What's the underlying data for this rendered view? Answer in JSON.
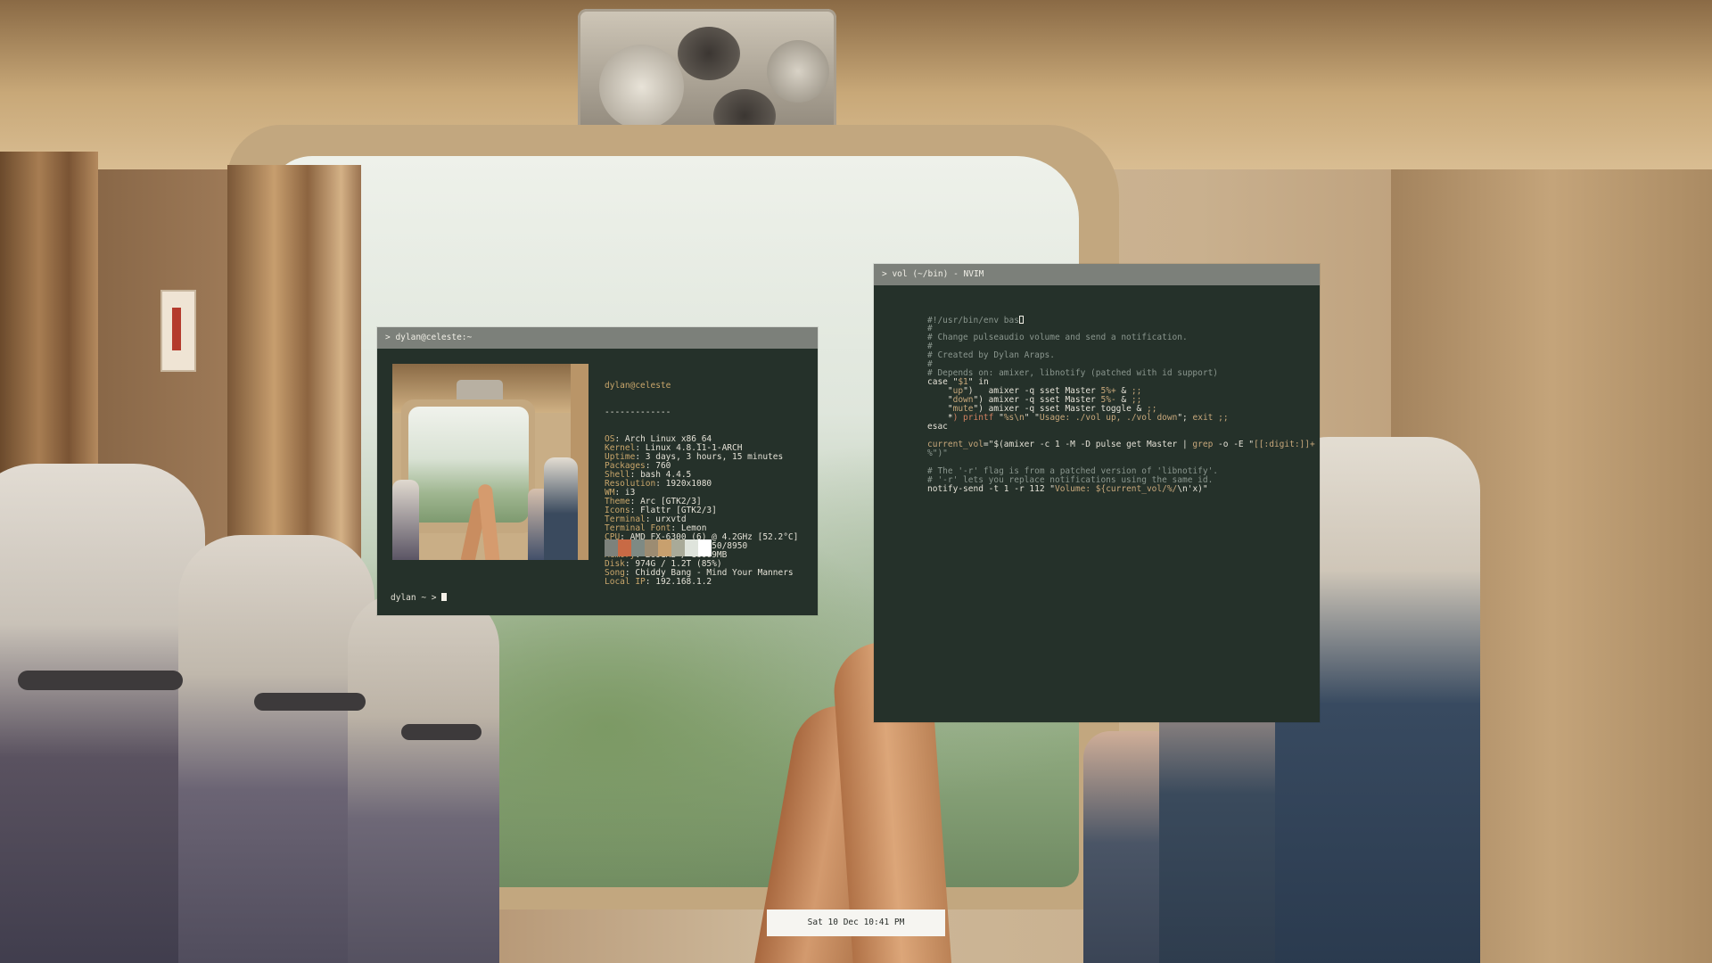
{
  "neofetch_window": {
    "title": "> dylan@celeste:~",
    "host": "dylan@celeste",
    "separator": "-------------",
    "info": [
      {
        "label": "OS",
        "value": "Arch Linux x86_64"
      },
      {
        "label": "Kernel",
        "value": "Linux 4.8.11-1-ARCH"
      },
      {
        "label": "Uptime",
        "value": "3 days, 3 hours, 15 minutes"
      },
      {
        "label": "Packages",
        "value": "760"
      },
      {
        "label": "Shell",
        "value": "bash 4.4.5"
      },
      {
        "label": "Resolution",
        "value": "1920x1080"
      },
      {
        "label": "WM",
        "value": "i3"
      },
      {
        "label": "Theme",
        "value": "Arc [GTK2/3]"
      },
      {
        "label": "Icons",
        "value": "Flattr [GTK2/3]"
      },
      {
        "label": "Terminal",
        "value": "urxvtd"
      },
      {
        "label": "Terminal Font",
        "value": "Lemon"
      },
      {
        "label": "CPU",
        "value": "AMD FX-6300 (6) @ 4.2GHz [52.2°C]"
      },
      {
        "label": "GPU",
        "value": "AMD Radeon HD 7950/8950"
      },
      {
        "label": "Memory",
        "value": "2691MB / 16009MB"
      },
      {
        "label": "Disk",
        "value": "974G / 1.2T (85%)"
      },
      {
        "label": "Song",
        "value": "Chiddy Bang - Mind Your Manners"
      },
      {
        "label": "Local IP",
        "value": "192.168.1.2"
      }
    ],
    "palette": [
      "#7d827c",
      "#c86a45",
      "#7e8a84",
      "#9c8c72",
      "#c8a06e",
      "#a9aa98",
      "#dfe4dc",
      "#ffffff"
    ],
    "prompt": "dylan ~ >"
  },
  "nvim_window": {
    "title": "> vol (~/bin) - NVIM",
    "lines": [
      [
        {
          "t": "#!/usr/bin/env bas",
          "c": "cm"
        }
      ],
      [
        {
          "t": "#",
          "c": "cm"
        }
      ],
      [
        {
          "t": "# Change pulseaudio volume and send a notification.",
          "c": "cm"
        }
      ],
      [
        {
          "t": "#",
          "c": "cm"
        }
      ],
      [
        {
          "t": "# Created by Dylan Araps.",
          "c": "cm"
        }
      ],
      [
        {
          "t": "#",
          "c": "cm"
        }
      ],
      [
        {
          "t": "# Depends on: amixer, libnotify (patched with id support)",
          "c": "cm"
        }
      ],
      [
        {
          "t": "case \"",
          "c": "pl"
        },
        {
          "t": "$1",
          "c": "str"
        },
        {
          "t": "\" in",
          "c": "pl"
        }
      ],
      [
        {
          "t": "    \"",
          "c": "pl"
        },
        {
          "t": "up",
          "c": "str"
        },
        {
          "t": "\")   amixer -q sset Master ",
          "c": "pl"
        },
        {
          "t": "5%+",
          "c": "str"
        },
        {
          "t": " & ",
          "c": "pl"
        },
        {
          "t": ";;",
          "c": "kw"
        }
      ],
      [
        {
          "t": "    \"",
          "c": "pl"
        },
        {
          "t": "down",
          "c": "str"
        },
        {
          "t": "\") amixer -q sset Master ",
          "c": "pl"
        },
        {
          "t": "5%-",
          "c": "str"
        },
        {
          "t": " & ",
          "c": "pl"
        },
        {
          "t": ";;",
          "c": "kw"
        }
      ],
      [
        {
          "t": "    \"",
          "c": "pl"
        },
        {
          "t": "mute",
          "c": "str"
        },
        {
          "t": "\") amixer -q sset Master toggle & ",
          "c": "pl"
        },
        {
          "t": ";;",
          "c": "kw"
        }
      ],
      [
        {
          "t": "    *",
          "c": "pl"
        },
        {
          "t": ") printf",
          "c": "red"
        },
        {
          "t": " \"",
          "c": "pl"
        },
        {
          "t": "%s\\n",
          "c": "str"
        },
        {
          "t": "\" \"",
          "c": "pl"
        },
        {
          "t": "Usage: ./vol up, ./vol down",
          "c": "str"
        },
        {
          "t": "\"; ",
          "c": "pl"
        },
        {
          "t": "exit",
          "c": "kw"
        },
        {
          "t": " ;;",
          "c": "kw"
        }
      ],
      [
        {
          "t": "esac",
          "c": "pl"
        }
      ],
      [
        {
          "t": "",
          "c": "pl"
        }
      ],
      [
        {
          "t": "current_vol",
          "c": "var"
        },
        {
          "t": "=\"$(amixer -c 1 -M -D pulse get Master | ",
          "c": "pl"
        },
        {
          "t": "grep",
          "c": "kw"
        },
        {
          "t": " -o -E \"",
          "c": "pl"
        },
        {
          "t": "[[:digit:]]+",
          "c": "str"
        }
      ],
      [
        {
          "t": "%\")\"",
          "c": "cm"
        }
      ],
      [
        {
          "t": "",
          "c": "pl"
        }
      ],
      [
        {
          "t": "# The '-r' flag is from a patched version of 'libnotify'.",
          "c": "cm"
        }
      ],
      [
        {
          "t": "# '-r' lets you replace notifications using the same id.",
          "c": "cm"
        }
      ],
      [
        {
          "t": "notify-send -t 1 -r 112 \"",
          "c": "pl"
        },
        {
          "t": "Volume: ",
          "c": "str"
        },
        {
          "t": "${current_vol/%/",
          "c": "var"
        },
        {
          "t": "\\n'x)\"",
          "c": "pl"
        }
      ]
    ]
  },
  "clock": {
    "text": "Sat 10 Dec 10:41 PM"
  }
}
